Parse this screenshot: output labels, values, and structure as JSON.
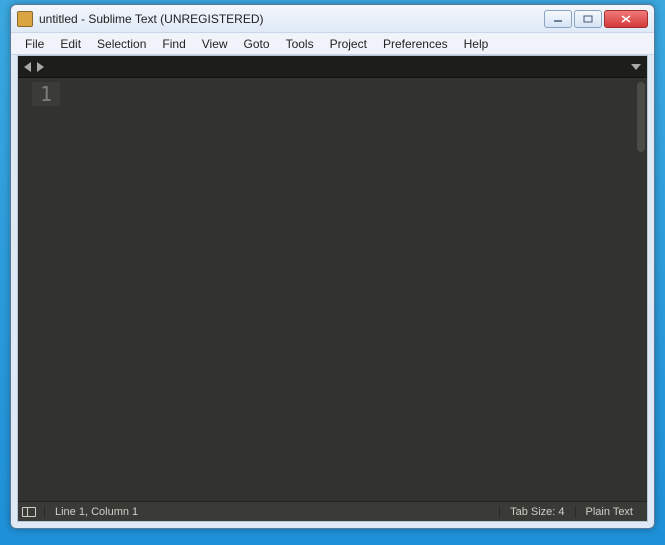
{
  "title": "untitled - Sublime Text (UNREGISTERED)",
  "menu": [
    "File",
    "Edit",
    "Selection",
    "Find",
    "View",
    "Goto",
    "Tools",
    "Project",
    "Preferences",
    "Help"
  ],
  "gutter": {
    "line1": "1"
  },
  "status": {
    "position": "Line 1, Column 1",
    "tabsize": "Tab Size: 4",
    "syntax": "Plain Text"
  }
}
